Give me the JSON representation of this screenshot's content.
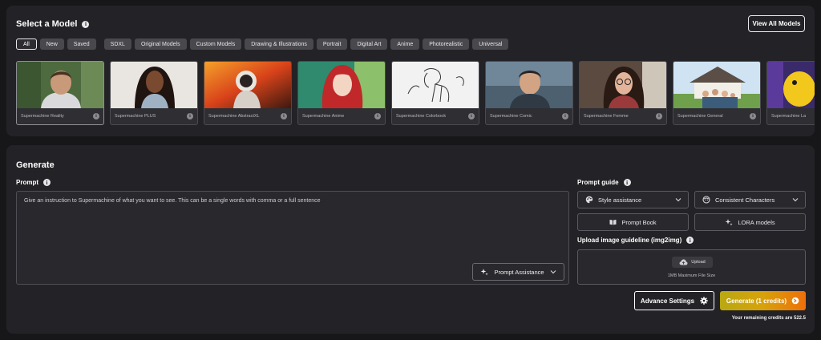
{
  "select_model": {
    "title": "Select a Model",
    "view_all_label": "View All Models",
    "filters": [
      {
        "label": "All",
        "active": true
      },
      {
        "label": "New"
      },
      {
        "label": "Saved"
      },
      {
        "label": "SDXL"
      },
      {
        "label": "Original Models"
      },
      {
        "label": "Custom Models"
      },
      {
        "label": "Drawing & Illustrations"
      },
      {
        "label": "Portrait"
      },
      {
        "label": "Digital Art"
      },
      {
        "label": "Anime"
      },
      {
        "label": "Photorealistic"
      },
      {
        "label": "Universal"
      }
    ],
    "models": [
      {
        "name": "Supermachine Reality",
        "thumb": "man-portrait"
      },
      {
        "name": "Supermachine PLUS",
        "thumb": "woman-portrait"
      },
      {
        "name": "Supermachine AbstractXL",
        "thumb": "astronaut-fire"
      },
      {
        "name": "Supermachine Anime",
        "thumb": "anime-girl"
      },
      {
        "name": "Supermachine Colorbook",
        "thumb": "line-art-horse"
      },
      {
        "name": "Supermachine Comic",
        "thumb": "comic-man"
      },
      {
        "name": "Supermachine Femme",
        "thumb": "woman-glasses"
      },
      {
        "name": "Supermachine General",
        "thumb": "family-house"
      },
      {
        "name": "Supermachine La",
        "thumb": "yellow-figure"
      }
    ]
  },
  "generate": {
    "title": "Generate",
    "prompt_label": "Prompt",
    "prompt_placeholder": "Give an instruction to Supermachine of what you want to see. This can be a single words with comma or a full sentence",
    "prompt_assistance_label": "Prompt Assistance",
    "prompt_guide_label": "Prompt guide",
    "style_assistance_label": "Style assistance",
    "consistent_characters_label": "Consistent Characters",
    "prompt_book_label": "Prompt Book",
    "lora_models_label": "LORA models",
    "upload_label": "Upload image guideline (img2img)",
    "upload_button_label": "Upload",
    "upload_note": "1MB Maximum File Size",
    "advance_settings_label": "Advance Settings",
    "generate_button_label": "Generate (1 credits)",
    "credits_text": "Your remaining credits are 522.5"
  },
  "colors": {
    "background": "#171719",
    "panel": "#232327",
    "generate_gradient_start": "#b9a812",
    "generate_gradient_end": "#ee6f0a"
  }
}
